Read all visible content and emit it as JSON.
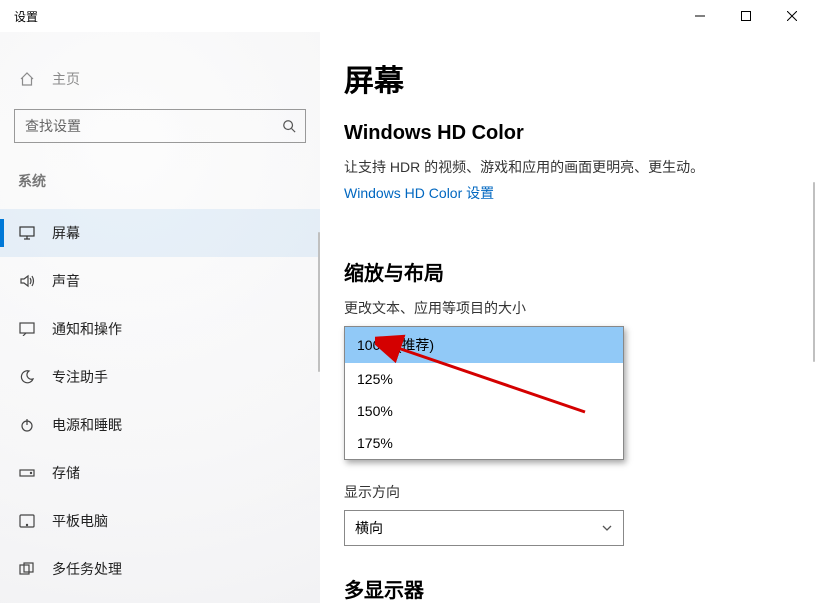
{
  "window": {
    "title": "设置"
  },
  "sidebar": {
    "home": "主页",
    "search_placeholder": "查找设置",
    "section": "系统",
    "items": [
      {
        "label": "屏幕"
      },
      {
        "label": "声音"
      },
      {
        "label": "通知和操作"
      },
      {
        "label": "专注助手"
      },
      {
        "label": "电源和睡眠"
      },
      {
        "label": "存储"
      },
      {
        "label": "平板电脑"
      },
      {
        "label": "多任务处理"
      }
    ]
  },
  "content": {
    "title": "屏幕",
    "hd_heading": "Windows HD Color",
    "hd_desc": "让支持 HDR 的视频、游戏和应用的画面更明亮、更生动。",
    "hd_link": "Windows HD Color 设置",
    "scale_heading": "缩放与布局",
    "scale_label": "更改文本、应用等项目的大小",
    "scale_options": [
      "100% (推荐)",
      "125%",
      "150%",
      "175%"
    ],
    "scale_selected": "100% (推荐)",
    "orientation_label": "显示方向",
    "orientation_value": "横向",
    "multi_heading": "多显示器"
  }
}
